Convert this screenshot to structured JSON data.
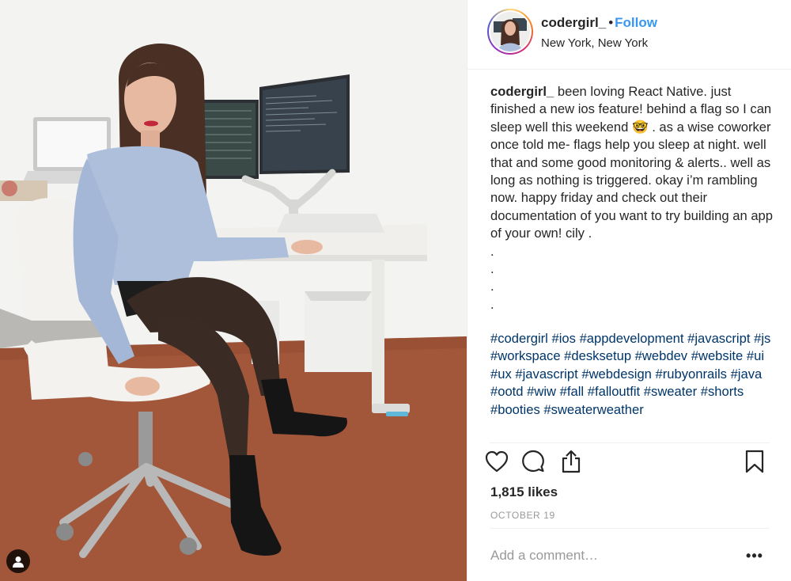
{
  "post": {
    "username": "codergirl_",
    "separator": "•",
    "follow_label": "Follow",
    "location": "New York, New York",
    "caption_body": "been loving React Native. just finished a new ios feature! behind a flag so I can sleep well this weekend 🤓 . as a wise coworker once told me- flags help you sleep at night. well that and some good monitoring & alerts.. well as long as nothing is triggered. okay i’m rambling now. happy friday and check out their documentation of you want to try building an app of your own! cily .\n.\n.\n.\n.",
    "hashtags": [
      "#codergirl",
      "#ios",
      "#appdevelopment",
      "#javascript",
      "#js",
      "#workspace",
      "#desksetup",
      "#webdev",
      "#website",
      "#ui",
      "#ux",
      "#javascript",
      "#webdesign",
      "#rubyonrails",
      "#java",
      "#ootd",
      "#wiw",
      "#fall",
      "#falloutfit",
      "#sweater",
      "#shorts",
      "#booties",
      "#sweaterweather"
    ],
    "likes": "1,815 likes",
    "date": "OCTOBER 19",
    "comment_placeholder": "Add a comment…",
    "more_label": "•••"
  },
  "icons": {
    "like": "heart-icon",
    "comment": "comment-icon",
    "share": "share-icon",
    "save": "bookmark-icon",
    "user_tag": "user-tag-icon"
  },
  "colors": {
    "follow": "#3897f0",
    "hashtag": "#003569",
    "text": "#262626",
    "muted": "#999999",
    "border": "#efefef"
  }
}
